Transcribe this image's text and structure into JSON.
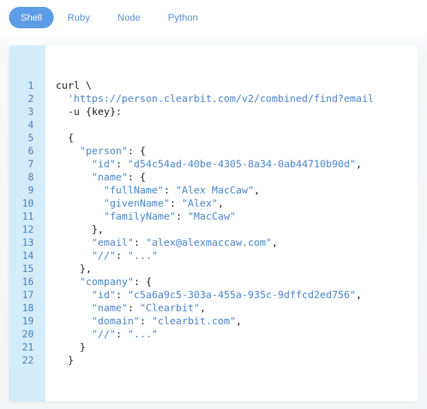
{
  "tabs": [
    {
      "label": "Shell",
      "active": true
    },
    {
      "label": "Ruby",
      "active": false
    },
    {
      "label": "Node",
      "active": false
    },
    {
      "label": "Python",
      "active": false
    }
  ],
  "colors": {
    "accent": "#5d9ce6",
    "tab_text": "#5a8ed0",
    "gutter_bg": "#d2ecf9",
    "line_number": "#4a7fc0",
    "string": "#4a85c9",
    "code_text": "#222222"
  },
  "code": {
    "lines": [
      {
        "n": "1",
        "tokens": [
          [
            "p",
            "curl \\"
          ]
        ]
      },
      {
        "n": "2",
        "tokens": [
          [
            "p",
            "  "
          ],
          [
            "str",
            "'https://person.clearbit.com/v2/combined/find?email"
          ]
        ]
      },
      {
        "n": "3",
        "tokens": [
          [
            "p",
            "  -u {key}:"
          ]
        ]
      },
      {
        "n": "4",
        "tokens": []
      },
      {
        "n": "5",
        "tokens": [
          [
            "p",
            "  {"
          ]
        ]
      },
      {
        "n": "6",
        "tokens": [
          [
            "p",
            "    "
          ],
          [
            "str",
            "\"person\""
          ],
          [
            "p",
            ": {"
          ]
        ]
      },
      {
        "n": "7",
        "tokens": [
          [
            "p",
            "      "
          ],
          [
            "str",
            "\"id\""
          ],
          [
            "p",
            ": "
          ],
          [
            "str",
            "\"d54c54ad-40be-4305-8a34-0ab44710b90d\""
          ],
          [
            "p",
            ","
          ]
        ]
      },
      {
        "n": "8",
        "tokens": [
          [
            "p",
            "      "
          ],
          [
            "str",
            "\"name\""
          ],
          [
            "p",
            ": {"
          ]
        ]
      },
      {
        "n": "9",
        "tokens": [
          [
            "p",
            "        "
          ],
          [
            "str",
            "\"fullName\""
          ],
          [
            "p",
            ": "
          ],
          [
            "str",
            "\"Alex MacCaw\""
          ],
          [
            "p",
            ","
          ]
        ]
      },
      {
        "n": "10",
        "tokens": [
          [
            "p",
            "        "
          ],
          [
            "str",
            "\"givenName\""
          ],
          [
            "p",
            ": "
          ],
          [
            "str",
            "\"Alex\""
          ],
          [
            "p",
            ","
          ]
        ]
      },
      {
        "n": "11",
        "tokens": [
          [
            "p",
            "        "
          ],
          [
            "str",
            "\"familyName\""
          ],
          [
            "p",
            ": "
          ],
          [
            "str",
            "\"MacCaw\""
          ]
        ]
      },
      {
        "n": "12",
        "tokens": [
          [
            "p",
            "      },"
          ]
        ]
      },
      {
        "n": "13",
        "tokens": [
          [
            "p",
            "      "
          ],
          [
            "str",
            "\"email\""
          ],
          [
            "p",
            ": "
          ],
          [
            "str",
            "\"alex@alexmaccaw.com\""
          ],
          [
            "p",
            ","
          ]
        ]
      },
      {
        "n": "14",
        "tokens": [
          [
            "p",
            "      "
          ],
          [
            "str",
            "\"//\""
          ],
          [
            "p",
            ": "
          ],
          [
            "str",
            "\"...\""
          ]
        ]
      },
      {
        "n": "15",
        "tokens": [
          [
            "p",
            "    },"
          ]
        ]
      },
      {
        "n": "16",
        "tokens": [
          [
            "p",
            "    "
          ],
          [
            "str",
            "\"company\""
          ],
          [
            "p",
            ": {"
          ]
        ]
      },
      {
        "n": "17",
        "tokens": [
          [
            "p",
            "      "
          ],
          [
            "str",
            "\"id\""
          ],
          [
            "p",
            ": "
          ],
          [
            "str",
            "\"c5a6a9c5-303a-455a-935c-9dffcd2ed756\""
          ],
          [
            "p",
            ","
          ]
        ]
      },
      {
        "n": "18",
        "tokens": [
          [
            "p",
            "      "
          ],
          [
            "str",
            "\"name\""
          ],
          [
            "p",
            ": "
          ],
          [
            "str",
            "\"Clearbit\""
          ],
          [
            "p",
            ","
          ]
        ]
      },
      {
        "n": "19",
        "tokens": [
          [
            "p",
            "      "
          ],
          [
            "str",
            "\"domain\""
          ],
          [
            "p",
            ": "
          ],
          [
            "str",
            "\"clearbit.com\""
          ],
          [
            "p",
            ","
          ]
        ]
      },
      {
        "n": "20",
        "tokens": [
          [
            "p",
            "      "
          ],
          [
            "str",
            "\"//\""
          ],
          [
            "p",
            ": "
          ],
          [
            "str",
            "\"...\""
          ]
        ]
      },
      {
        "n": "21",
        "tokens": [
          [
            "p",
            "    }"
          ]
        ]
      },
      {
        "n": "22",
        "tokens": [
          [
            "p",
            "  }"
          ]
        ]
      }
    ]
  }
}
